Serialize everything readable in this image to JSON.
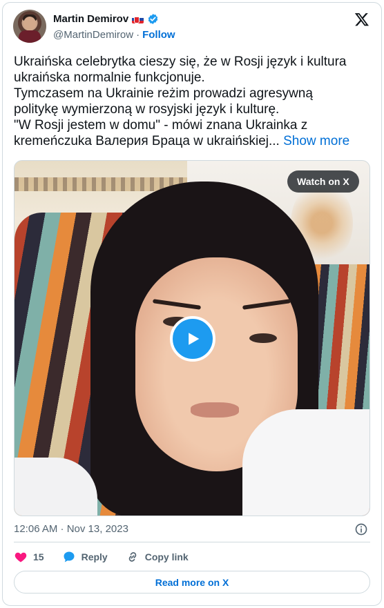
{
  "author": {
    "name": "Martin Demirov",
    "handle": "@MartinDemirow",
    "separator": "·",
    "follow_label": "Follow"
  },
  "tweet": {
    "lines": [
      "Ukraińska celebrytka cieszy się, że w Rosji język i kultura",
      "ukraińska normalnie funkcjonuje.",
      "Tymczasem na Ukrainie reżim prowadzi agresywną",
      "politykę wymierzoną w rosyjski język i kulturę.",
      "\"W Rosji jestem w domu\" - mówi znana Ukrainka z"
    ],
    "last_line": "kremeńczuka Валерия Браца w ukraińskiej...",
    "show_more": "Show more"
  },
  "media": {
    "watch_label": "Watch on X"
  },
  "timestamp": "12:06 AM · Nov 13, 2023",
  "actions": {
    "like_count": "15",
    "reply_label": "Reply",
    "copy_label": "Copy link"
  },
  "read_more_label": "Read more on X",
  "colors": {
    "link": "#006fd6",
    "verified": "#1d9bf0",
    "like": "#f91880",
    "text": "#0f1419",
    "secondary": "#536471"
  },
  "icons": [
    "flag-slovakia-icon",
    "verified-badge-icon",
    "x-logo-icon",
    "play-icon",
    "info-icon",
    "heart-icon",
    "reply-bubble-icon",
    "link-icon"
  ]
}
